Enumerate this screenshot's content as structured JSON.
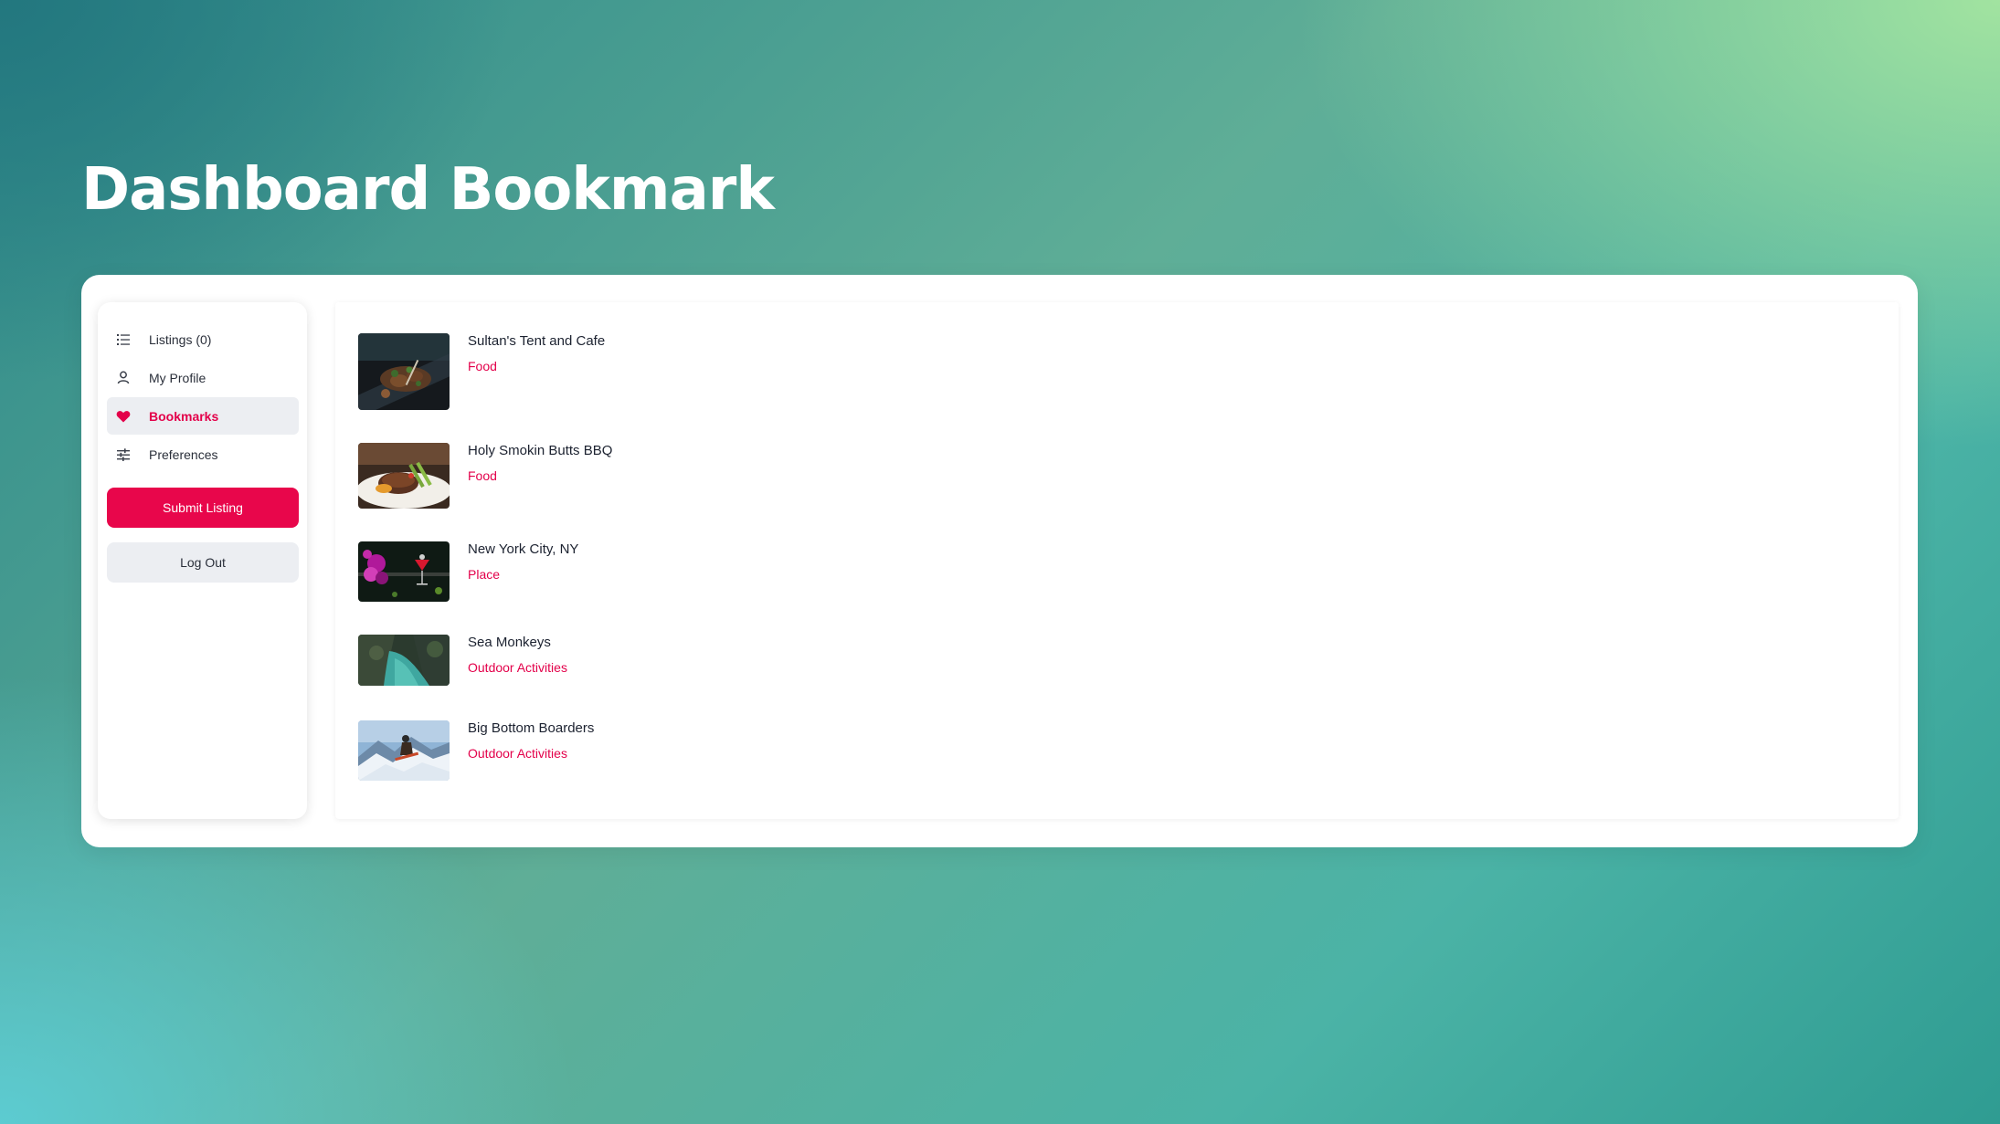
{
  "page": {
    "title": "Dashboard Bookmark"
  },
  "sidebar": {
    "items": [
      {
        "label": "Listings (0)",
        "icon": "list-icon",
        "active": false
      },
      {
        "label": "My Profile",
        "icon": "user-icon",
        "active": false
      },
      {
        "label": "Bookmarks",
        "icon": "heart-icon",
        "active": true
      },
      {
        "label": "Preferences",
        "icon": "sliders-icon",
        "active": false
      }
    ],
    "submit_label": "Submit Listing",
    "logout_label": "Log Out"
  },
  "bookmarks": [
    {
      "title": "Sultan's Tent and Cafe",
      "category": "Food"
    },
    {
      "title": "Holy Smokin Butts BBQ",
      "category": "Food"
    },
    {
      "title": "New York City, NY",
      "category": "Place"
    },
    {
      "title": "Sea Monkeys",
      "category": "Outdoor Activities"
    },
    {
      "title": "Big Bottom Boarders",
      "category": "Outdoor Activities"
    }
  ],
  "colors": {
    "accent": "#e8064b",
    "active_bg": "#eceef2",
    "text": "#1c2230"
  }
}
